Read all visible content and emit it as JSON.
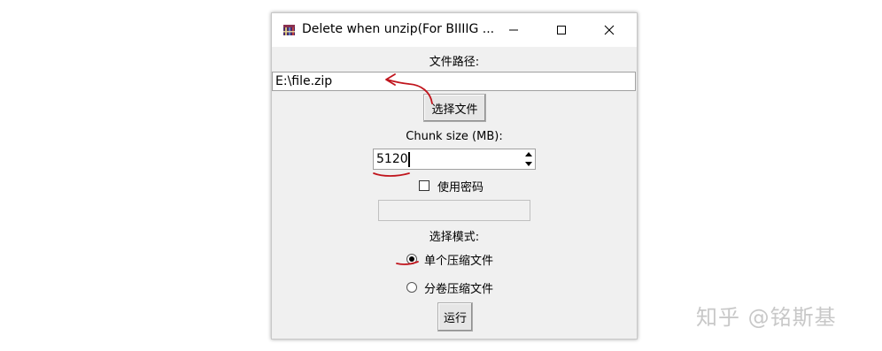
{
  "window": {
    "title": "Delete when unzip(For BIIIIG ...",
    "buttons": {
      "minimize": "minimize-icon",
      "maximize": "maximize-icon",
      "close": "close-icon"
    }
  },
  "file_path": {
    "label": "文件路径:",
    "value": "E:\\file.zip",
    "select_button": "选择文件"
  },
  "chunk": {
    "label": "Chunk size (MB):",
    "value": "5120"
  },
  "password": {
    "checkbox_label": "使用密码",
    "checked": false,
    "value": ""
  },
  "mode": {
    "label": "选择模式:",
    "options": [
      {
        "label": "单个压缩文件",
        "selected": true
      },
      {
        "label": "分卷压缩文件",
        "selected": false
      }
    ]
  },
  "run_button": "运行",
  "watermark": "知乎 @铭斯基",
  "colors": {
    "annotation_red": "#c0141c",
    "window_bg": "#f0f0f0"
  }
}
